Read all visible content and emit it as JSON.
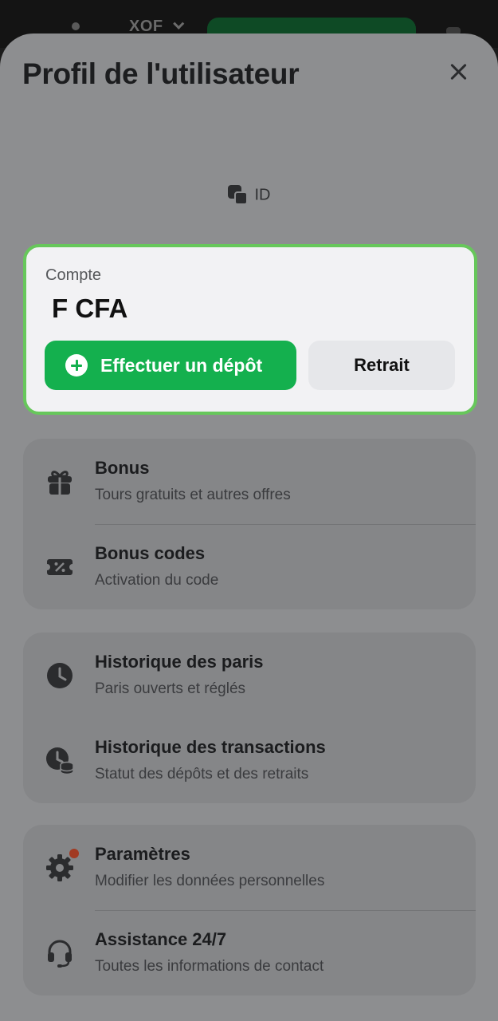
{
  "topbar": {
    "currency": "XOF"
  },
  "header": {
    "title": "Profil de l'utilisateur"
  },
  "profile": {
    "id_label": "ID"
  },
  "account": {
    "label": "Compte",
    "balance": "F CFA",
    "deposit_label": "Effectuer un dépôt",
    "withdraw_label": "Retrait",
    "accent_color": "#14b04e",
    "border_color": "#67c75b"
  },
  "menu": {
    "group1": [
      {
        "label": "Bonus",
        "sub": "Tours gratuits et autres offres",
        "icon": "gift-icon"
      },
      {
        "label": "Bonus codes",
        "sub": "Activation du code",
        "icon": "coupon-icon"
      }
    ],
    "group2": [
      {
        "label": "Historique des paris",
        "sub": "Paris ouverts et réglés",
        "icon": "clock-icon"
      },
      {
        "label": "Historique des transactions",
        "sub": "Statut des dépôts et des retraits",
        "icon": "clock-coins-icon"
      }
    ],
    "group3": [
      {
        "label": "Paramètres",
        "sub": "Modifier les données personnelles",
        "icon": "gear-icon"
      },
      {
        "label": "Assistance 24/7",
        "sub": "Toutes les informations de contact",
        "icon": "headset-icon"
      }
    ]
  }
}
